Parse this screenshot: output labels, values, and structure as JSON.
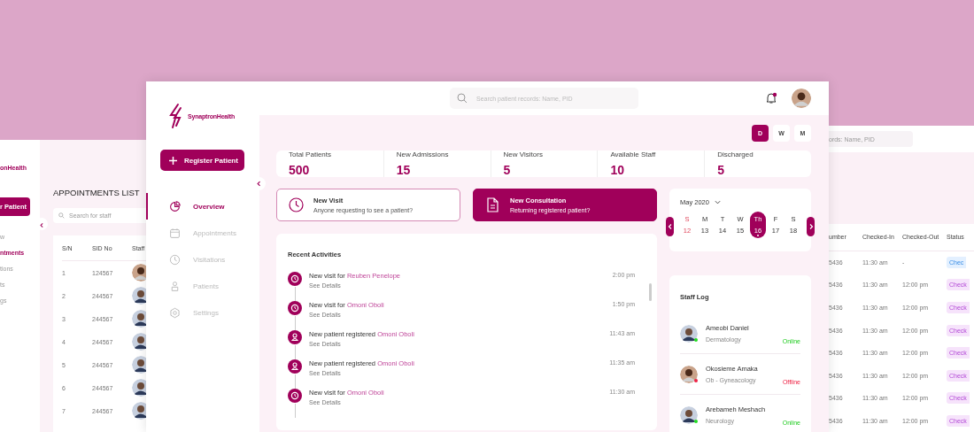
{
  "left_window": {
    "logo": "onHealth",
    "button": "r Patient",
    "nav": [
      {
        "label": "w",
        "selected": false
      },
      {
        "label": "ntments",
        "selected": true
      },
      {
        "label": "tions",
        "selected": false
      },
      {
        "label": "ts",
        "selected": false
      },
      {
        "label": "gs",
        "selected": false
      }
    ],
    "title": "APPOINTMENTS LIST",
    "search": {
      "placeholder": "Search for staff"
    },
    "columns": [
      "S/N",
      "SID No",
      "Staff"
    ],
    "rows": [
      {
        "sn": "1",
        "sid": "124567"
      },
      {
        "sn": "2",
        "sid": "244567"
      },
      {
        "sn": "3",
        "sid": "244567"
      },
      {
        "sn": "4",
        "sid": "244567"
      },
      {
        "sn": "5",
        "sid": "244567"
      },
      {
        "sn": "6",
        "sid": "244567"
      },
      {
        "sn": "7",
        "sid": "244567"
      }
    ]
  },
  "main_window": {
    "logo": "SynaptronHealth",
    "register_button": "Register Patient",
    "nav": [
      {
        "label": "Overview",
        "selected": true
      },
      {
        "label": "Appointments",
        "selected": false
      },
      {
        "label": "Visitations",
        "selected": false
      },
      {
        "label": "Patients",
        "selected": false
      },
      {
        "label": "Settings",
        "selected": false
      }
    ],
    "search": {
      "placeholder": "Search patient records: Name, PID"
    },
    "notification": true,
    "period_toggle": [
      {
        "label": "D",
        "selected": true
      },
      {
        "label": "W",
        "selected": false
      },
      {
        "label": "M",
        "selected": false
      }
    ],
    "stats": [
      {
        "label": "Total Patients",
        "value": "500"
      },
      {
        "label": "New Admissions",
        "value": "15"
      },
      {
        "label": "New Visitors",
        "value": "5"
      },
      {
        "label": "Available Staff",
        "value": "10"
      },
      {
        "label": "Discharged",
        "value": "5"
      }
    ],
    "quick_actions": [
      {
        "kind": "visit",
        "title": "New Visit",
        "subtitle": "Anyone requesting to see a patient?",
        "selected": false
      },
      {
        "kind": "consultation",
        "title": "New Consultation",
        "subtitle": "Returning registered patient?",
        "selected": true
      }
    ],
    "calendar": {
      "month": "May 2020",
      "days": [
        {
          "weekday": "S",
          "date": "12",
          "kind": "sunday",
          "selected": false
        },
        {
          "weekday": "M",
          "date": "13",
          "kind": "weekday",
          "selected": false
        },
        {
          "weekday": "T",
          "date": "14",
          "kind": "weekday",
          "selected": false
        },
        {
          "weekday": "W",
          "date": "15",
          "kind": "weekday",
          "selected": false
        },
        {
          "weekday": "Th",
          "date": "16",
          "kind": "weekday",
          "selected": true
        },
        {
          "weekday": "F",
          "date": "17",
          "kind": "weekday",
          "selected": false
        },
        {
          "weekday": "S",
          "date": "18",
          "kind": "weekday",
          "selected": false
        }
      ]
    },
    "activities": {
      "title": "Recent Activities",
      "items": [
        {
          "kind": "visit",
          "text": "New visit for",
          "name": "Reuben Penelope",
          "details": "See Details",
          "time": "2:00 pm"
        },
        {
          "kind": "visit",
          "text": "New visit for",
          "name": "Omoni Oboli",
          "details": "See Details",
          "time": "1:50 pm"
        },
        {
          "kind": "patient",
          "text": "New patient registered",
          "name": "Omoni Oboli",
          "details": "See Details",
          "time": "11:43 am"
        },
        {
          "kind": "patient",
          "text": "New patient registered",
          "name": "Omoni Oboli",
          "details": "See Details",
          "time": "11:35 am"
        },
        {
          "kind": "visit",
          "text": "New visit for",
          "name": "Omoni Oboli",
          "details": "See Details",
          "time": "11:30 am"
        }
      ]
    },
    "staff_log": {
      "title": "Staff Log",
      "items": [
        {
          "name": "Ameobi Daniel",
          "department": "Dermatology",
          "status": "Online",
          "online": true
        },
        {
          "name": "Okosieme Amaka",
          "department": "Ob - Gyneacology",
          "status": "Offline",
          "online": false
        },
        {
          "name": "Arebameh Meshach",
          "department": "Neurology",
          "status": "Online",
          "online": true
        }
      ]
    }
  },
  "right_window": {
    "search": {
      "placeholder": "ords: Name, PID"
    },
    "columns": [
      "umber",
      "Checked-In",
      "Checked-Out",
      "Status"
    ],
    "rows": [
      {
        "number": "5436",
        "checked_in": "11:30 am",
        "checked_out": "-",
        "status": "Chec",
        "kind": "in"
      },
      {
        "number": "5436",
        "checked_in": "11:30 am",
        "checked_out": "12:00 pm",
        "status": "Check",
        "kind": "out"
      },
      {
        "number": "5436",
        "checked_in": "11:30 am",
        "checked_out": "12:00 pm",
        "status": "Check",
        "kind": "out"
      },
      {
        "number": "5436",
        "checked_in": "11:30 am",
        "checked_out": "12:00 pm",
        "status": "Check",
        "kind": "out"
      },
      {
        "number": "5436",
        "checked_in": "11:30 am",
        "checked_out": "12:00 pm",
        "status": "Check",
        "kind": "out"
      },
      {
        "number": "5436",
        "checked_in": "11:30 am",
        "checked_out": "12:00 pm",
        "status": "Check",
        "kind": "out"
      },
      {
        "number": "5436",
        "checked_in": "11:30 am",
        "checked_out": "12:00 pm",
        "status": "Check",
        "kind": "out"
      },
      {
        "number": "5436",
        "checked_in": "11:30 am",
        "checked_out": "12:00 pm",
        "status": "Check",
        "kind": "out"
      }
    ]
  }
}
